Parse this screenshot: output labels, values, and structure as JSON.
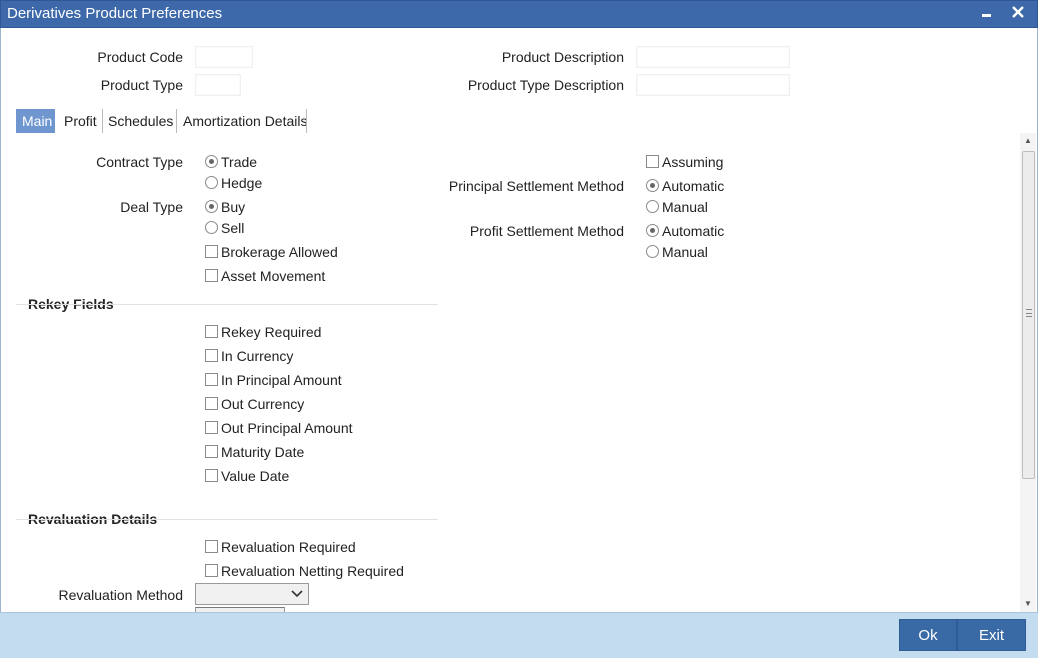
{
  "window": {
    "title": "Derivatives Product Preferences",
    "minimize_glyph": "▬",
    "close_glyph": "✕"
  },
  "header": {
    "product_code_label": "Product Code",
    "product_type_label": "Product Type",
    "product_description_label": "Product Description",
    "product_type_description_label": "Product Type Description",
    "product_code_value": "",
    "product_type_value": "",
    "product_description_value": "",
    "product_type_description_value": ""
  },
  "tabs": [
    {
      "label": "Main",
      "active": true
    },
    {
      "label": "Profit",
      "active": false
    },
    {
      "label": "Schedules",
      "active": false
    },
    {
      "label": "Amortization Details",
      "active": false
    }
  ],
  "main": {
    "contract_type": {
      "label": "Contract Type",
      "options": [
        "Trade",
        "Hedge"
      ],
      "selected": "Trade"
    },
    "deal_type": {
      "label": "Deal Type",
      "options": [
        "Buy",
        "Sell"
      ],
      "selected": "Buy"
    },
    "brokerage_allowed": "Brokerage Allowed",
    "asset_movement": "Asset Movement",
    "assuming": "Assuming",
    "principal_settlement": {
      "label": "Principal Settlement Method",
      "options": [
        "Automatic",
        "Manual"
      ],
      "selected": "Automatic"
    },
    "profit_settlement": {
      "label": "Profit Settlement Method",
      "options": [
        "Automatic",
        "Manual"
      ],
      "selected": "Automatic"
    }
  },
  "rekey": {
    "title": "Rekey Fields",
    "items": [
      "Rekey Required",
      "In Currency",
      "In Principal Amount",
      "Out Currency",
      "Out Principal Amount",
      "Maturity Date",
      "Value Date"
    ]
  },
  "revaluation": {
    "title": "Revaluation Details",
    "required": "Revaluation Required",
    "netting_required": "Revaluation Netting Required",
    "method_label": "Revaluation Method",
    "method_value": ""
  },
  "footer": {
    "ok": "Ok",
    "exit": "Exit"
  },
  "colors": {
    "titlebar": "#3d68a9",
    "active_tab": "#6f96cf",
    "footer": "#c4dcef",
    "button": "#3a6aa5"
  }
}
